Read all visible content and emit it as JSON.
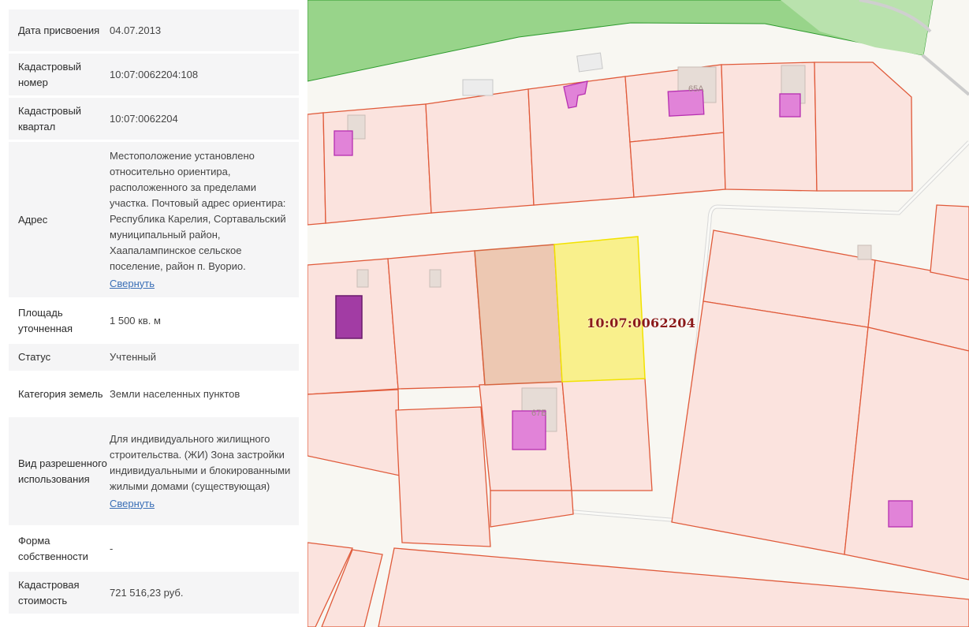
{
  "details": [
    {
      "label": "Дата присвоения",
      "value": "04.07.2013"
    },
    {
      "label": "Кадастровый номер",
      "value": "10:07:0062204:108"
    },
    {
      "label": "Кадастровый квартал",
      "value": "10:07:0062204"
    },
    {
      "label": "Адрес",
      "value": "Местоположение установлено относительно ориентира, расположенного за пределами участка. Почтовый адрес ориентира: Республика Карелия, Сортавальский муниципальный район, Хаапалампинское сельское поселение, район п. Вуорио.",
      "link": "Свернуть"
    },
    {
      "label": "Площадь уточненная",
      "value": "1 500 кв. м"
    },
    {
      "label": "Статус",
      "value": "Учтенный"
    },
    {
      "label": "Категория земель",
      "value": "Земли населенных пунктов"
    },
    {
      "label": "Вид разрешенного использования",
      "value": "Для индивидуального жилищного строительства. (ЖИ) Зона застройки индивидуальными и блокированными жилыми домами (существующая)",
      "link": "Свернуть"
    },
    {
      "label": "Форма собственности",
      "value": "-"
    },
    {
      "label": "Кадастровая стоимость",
      "value": "721 516,23 руб."
    }
  ],
  "map": {
    "quarter_label": "10:07:0062204",
    "house_labels": [
      "65А",
      "67Б"
    ],
    "colors": {
      "parcel_fill": "#fbe3de",
      "parcel_stroke": "#e05a3a",
      "selected_fill": "#f9f08c",
      "selected_stroke": "#f2e200",
      "building_fill": "#e183d8",
      "building_stroke": "#b62fb0",
      "forest": "#98d48a"
    }
  }
}
